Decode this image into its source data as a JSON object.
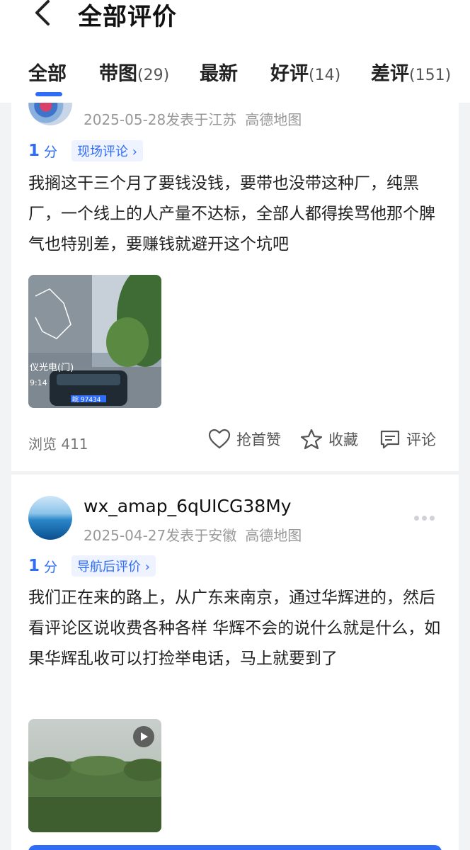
{
  "header": {
    "title": "全部评价",
    "tabs": [
      {
        "label": "全部",
        "count": ""
      },
      {
        "label": "带图",
        "count": "(29)"
      },
      {
        "label": "最新",
        "count": ""
      },
      {
        "label": "好评",
        "count": "(14)"
      },
      {
        "label": "差评",
        "count": "(151)"
      }
    ],
    "active_tab": "全部"
  },
  "reviews": [
    {
      "username": "",
      "date": "2025-05-28发表于江苏",
      "source": "高德地图",
      "score": "1",
      "score_unit": "分",
      "tag": "现场评论",
      "content": "我搁这干三个月了要钱没钱，要带也没带这种厂，纯黑厂，一个线上的人产量不达标，全部人都得挨骂他那个脾气也特别差，要赚钱就避开这个坑吧",
      "image_overlay_text": "仪光电(门)",
      "image_time": "9:14",
      "plate_text": "皖 97434",
      "views_label": "浏览 411",
      "like_label": "抢首赞",
      "fav_label": "收藏",
      "comment_label": "评论"
    },
    {
      "username": "wx_amap_6qUICG38My",
      "date": "2025-04-27发表于安徽",
      "source": "高德地图",
      "score": "1",
      "score_unit": "分",
      "tag": "导航后评价",
      "content": "我们正在来的路上，从广东来南京，通过华辉进的，然后看评论区说收费各种各样 华辉不会的说什么就是什么，如果华辉乱收可以打捡举电话，马上就要到了"
    }
  ],
  "colors": {
    "accent": "#2f6df6",
    "meta": "#999999",
    "background": "#f2f3f5"
  }
}
